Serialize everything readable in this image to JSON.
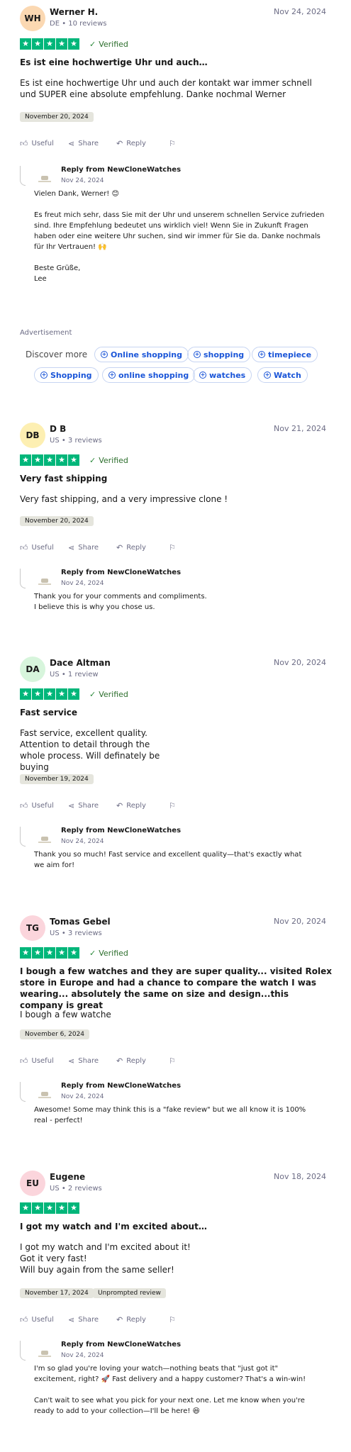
{
  "reviews": [
    {
      "initials": "WH",
      "avatar_color": "#fbd8b2",
      "name": "Werner H.",
      "meta": "DE • 10 reviews",
      "date": "Nov 24, 2024",
      "rating": 5,
      "verified": "Verified",
      "title": "Es ist eine hochwertige Uhr und auch…",
      "body": "Es ist eine hochwertige Uhr und auch der kontakt war immer schnell und SUPER eine absolute empfehlung. Danke nochmal Werner",
      "experience_date": "November 20, 2024",
      "actions": {
        "useful": "Useful",
        "share": "Share",
        "reply": "Reply"
      },
      "reply": {
        "from": "Reply from NewCloneWatches",
        "date": "Nov 24, 2024",
        "text": "Vielen Dank, Werner! 😊\n\nEs freut mich sehr, dass Sie mit der Uhr und unserem schnellen Service zufrieden sind. Ihre Empfehlung bedeutet uns wirklich viel! Wenn Sie in Zukunft Fragen haben oder eine weitere Uhr suchen, sind wir immer für Sie da. Danke nochmals für Ihr Vertrauen! 🙌\n\nBeste Grüße,\nLee"
      }
    },
    {
      "initials": "DB",
      "avatar_color": "#fdefb2",
      "name": "D B",
      "meta": "US • 3 reviews",
      "date": "Nov 21, 2024",
      "rating": 5,
      "verified": "Verified",
      "title": "Very fast shipping",
      "body": "Very fast shipping, and a very impressive clone !",
      "experience_date": "November 20, 2024",
      "actions": {
        "useful": "Useful",
        "share": "Share",
        "reply": "Reply"
      },
      "reply": {
        "from": "Reply from NewCloneWatches",
        "date": "Nov 24, 2024",
        "text": "Thank you for your comments and compliments.\nI believe this is why you chose us."
      }
    },
    {
      "initials": "DA",
      "avatar_color": "#d7f5dc",
      "name": "Dace Altman",
      "meta": "US • 1 review",
      "date": "Nov 20, 2024",
      "rating": 5,
      "verified": "Verified",
      "title": "Fast service",
      "body": "Fast service, excellent quality. Attention to detail through the whole process. Will definately be buying\nagain.",
      "experience_date": "November 19, 2024",
      "actions": {
        "useful": "Useful",
        "share": "Share",
        "reply": "Reply"
      },
      "reply": {
        "from": "Reply from NewCloneWatches",
        "date": "Nov 24, 2024",
        "text": "Thank you so much! Fast service and excellent quality—that's exactly what we aim for!"
      }
    },
    {
      "initials": "TG",
      "avatar_color": "#fbd5dc",
      "name": "Tomas Gebel",
      "meta": "US • 3 reviews",
      "date": "Nov 20, 2024",
      "rating": 5,
      "verified": "Verified",
      "title": "I bough a few watches and they are super quality... visited Rolex store in Europe and had a chance to compare the watch I was wearing... absolutely the same on size and design...this company is great",
      "body": "I bough a few watche",
      "experience_date": "November 6, 2024",
      "actions": {
        "useful": "Useful",
        "share": "Share",
        "reply": "Reply"
      },
      "reply": {
        "from": "Reply from NewCloneWatches",
        "date": "Nov 24, 2024",
        "text": "Awesome! Some may think this is a \"fake review\" but we all know it is 100% real - perfect!"
      }
    },
    {
      "initials": "EU",
      "avatar_color": "#fbd5dc",
      "name": "Eugene",
      "meta": "US • 2 reviews",
      "date": "Nov 18, 2024",
      "rating": 5,
      "verified": "",
      "title": "I got my watch and I'm excited about…",
      "body": "I got my watch and I'm excited about it!\nGot it very fast!\nWill buy again from the same seller!",
      "experience_date": "November 17, 2024",
      "badge": "Unprompted review",
      "actions": {
        "useful": "Useful",
        "share": "Share",
        "reply": "Reply"
      },
      "reply": {
        "from": "Reply from NewCloneWatches",
        "date": "Nov 24, 2024",
        "text": "I'm so glad you're loving your watch—nothing beats that \"just got it\" excitement, right? 🚀 Fast delivery and a happy customer? That's a win-win!\n\nCan't wait to see what you pick for your next one. Let me know when you're ready to add to your collection—I'll be here! 😆"
      }
    }
  ],
  "advertisement": {
    "label": "Advertisement",
    "discover": "Discover more",
    "pills": [
      "Online shopping",
      "shopping",
      "timepiece",
      "Shopping",
      "online shopping",
      "watches",
      "Watch"
    ]
  },
  "colors": {
    "star": "#00b67a",
    "link": "#1a55d8"
  },
  "icons": {
    "star": "star-icon",
    "check": "check-icon",
    "useful": "thumbs-up-icon",
    "share": "share-icon",
    "reply": "reply-icon",
    "flag": "flag-icon",
    "plus": "plus-circle-icon"
  }
}
